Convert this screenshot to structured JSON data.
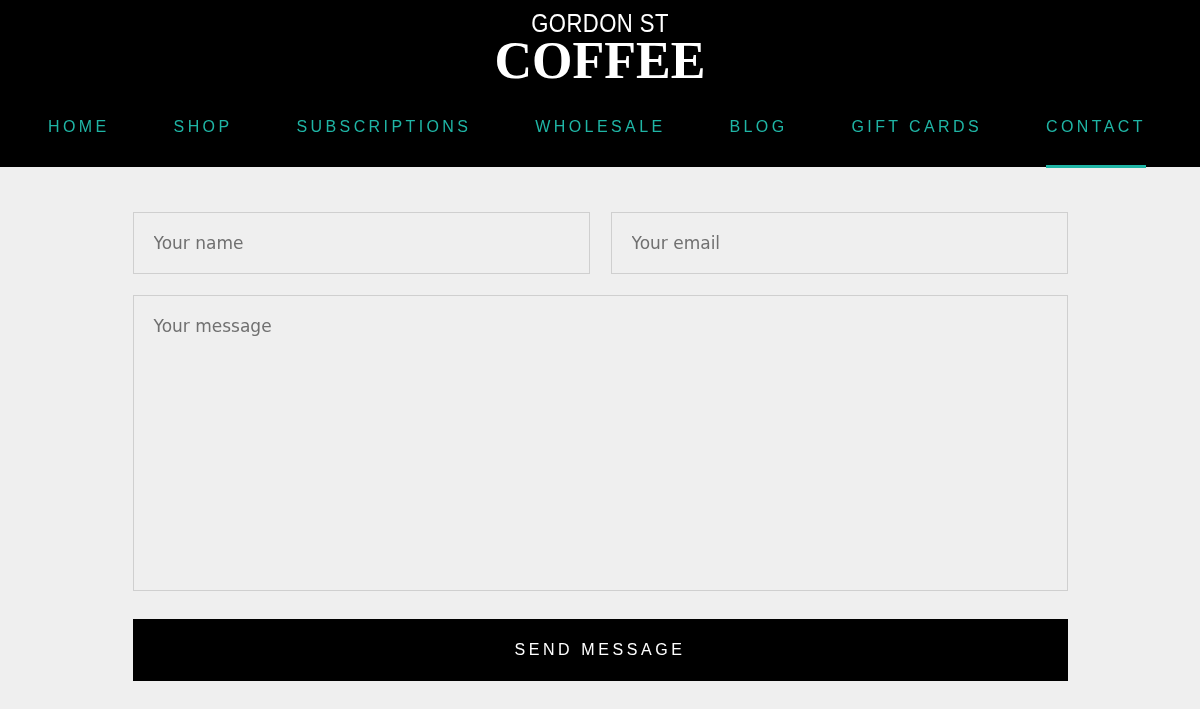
{
  "logo": {
    "line_1": "GORDON ST",
    "line_2": "COFFEE"
  },
  "nav": [
    {
      "label": "HOME",
      "selected": false
    },
    {
      "label": "SHOP",
      "selected": false
    },
    {
      "label": "SUBSCRIPTIONS",
      "selected": false
    },
    {
      "label": "WHOLESALE",
      "selected": false
    },
    {
      "label": "BLOG",
      "selected": false
    },
    {
      "label": "GIFT CARDS",
      "selected": false
    },
    {
      "label": "CONTACT",
      "selected": true
    }
  ],
  "form": {
    "name": {
      "placeholder": "Your name"
    },
    "email": {
      "placeholder": "Your email"
    },
    "message": {
      "placeholder": "Your message"
    },
    "submit": "SEND MESSAGE"
  }
}
